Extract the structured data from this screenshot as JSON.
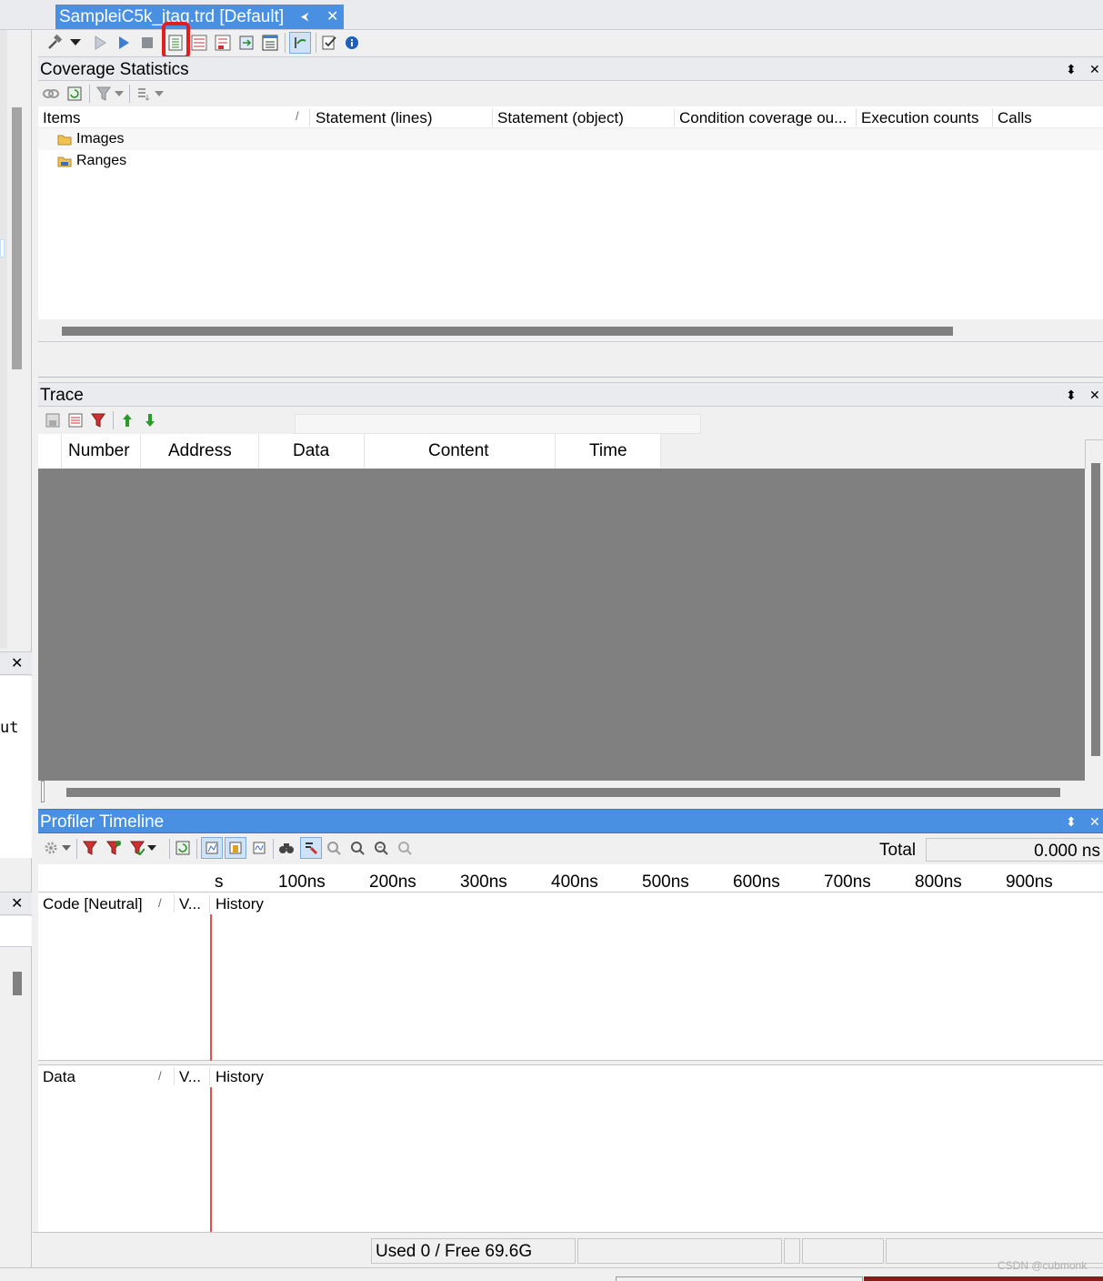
{
  "document_tab": {
    "title": "SampleiC5k_jtag.trd [Default]",
    "pin_glyph": "⮜",
    "close_glyph": "✕"
  },
  "left_panel": {
    "fragment_text": "ut",
    "close_glyph": "✕"
  },
  "coverage": {
    "title": "Coverage Statistics",
    "columns": [
      "Items",
      "Statement (lines)",
      "Statement (object)",
      "Condition coverage ou...",
      "Execution counts",
      "Calls"
    ],
    "sort_glyph": "/",
    "rows": [
      {
        "label": "Images"
      },
      {
        "label": "Ranges"
      }
    ]
  },
  "trace": {
    "title": "Trace",
    "columns": [
      "Number",
      "Address",
      "Data",
      "Content",
      "Time"
    ]
  },
  "profiler": {
    "title": "Profiler Timeline",
    "total_label": "Total",
    "total_value": "0.000 ns",
    "timeline_ticks": [
      "s",
      "100ns",
      "200ns",
      "300ns",
      "400ns",
      "500ns",
      "600ns",
      "700ns",
      "800ns",
      "900ns"
    ],
    "code_section": {
      "name_col": "Code [Neutral]",
      "sort_glyph": "/",
      "value_col": "V...",
      "history_col": "History"
    },
    "data_section": {
      "name_col": "Data",
      "sort_glyph": "/",
      "value_col": "V...",
      "history_col": "History"
    }
  },
  "panel_controls": {
    "dropdown_glyph": "⬍",
    "close_glyph": "✕"
  },
  "statusbar": {
    "memory": "Used 0 / Free 69.6G"
  },
  "watermark": "CSDN @cubmonk",
  "colors": {
    "accent": "#4a90e2",
    "highlight_box": "#e02020",
    "trace_empty": "#808080",
    "timeline_marker": "#e05050"
  }
}
